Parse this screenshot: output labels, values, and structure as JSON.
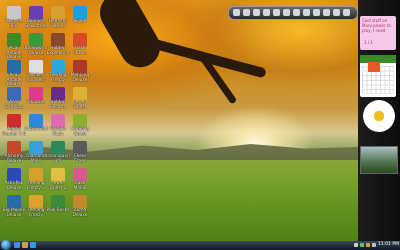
{
  "desktop": {
    "icons": [
      {
        "label": "Recycle Bin",
        "color": "#c8c8c8"
      },
      {
        "label": "Bonnie's Bookstore",
        "color": "#6a3fb5"
      },
      {
        "label": "Hamster Heroes",
        "color": "#d8a030"
      },
      {
        "label": "Skype",
        "color": "#1aa0e0"
      },
      {
        "label": "Acai Arcade Deluxe",
        "color": "#3b8a2a"
      },
      {
        "label": "Bookworm Deluxe",
        "color": "#3a9a3a"
      },
      {
        "label": "Hidden Expedition",
        "color": "#8a4a2a"
      },
      {
        "label": "Flash Puzzle",
        "color": "#d84a2a"
      },
      {
        "label": "Acai Arcade Deluxe",
        "color": "#2a6aa8"
      },
      {
        "label": "Chicken Invaders",
        "color": "#e0e0e0"
      },
      {
        "label": "Feeding Frenzy",
        "color": "#2aa8d8"
      },
      {
        "label": "Mahjong Deluxe",
        "color": "#a83a2a"
      },
      {
        "label": "Acer GridVista",
        "color": "#3a6ab8"
      },
      {
        "label": "Chuzzle",
        "color": "#e03a8a"
      },
      {
        "label": "Hidden Secrets",
        "color": "#6a2a8a"
      },
      {
        "label": "Jewel Quest",
        "color": "#e0b030"
      },
      {
        "label": "Adobe Reader 7.0",
        "color": "#d02a2a"
      },
      {
        "label": "Cubis Gold",
        "color": "#2a8ad8"
      },
      {
        "label": "Fashion Rush",
        "color": "#e06ab0"
      },
      {
        "label": "Mahjong Quest",
        "color": "#8ab030"
      },
      {
        "label": "Alchemy Deluxe",
        "color": "#c04a2a"
      },
      {
        "label": "Diamond Mine",
        "color": "#3aa0d8"
      },
      {
        "label": "Insaniquarium",
        "color": "#2a8a5a"
      },
      {
        "label": "Chess Titans",
        "color": "#5a5a5a"
      },
      {
        "label": "AstroPop Deluxe",
        "color": "#2a4ab8"
      },
      {
        "label": "Feeding Frenzy 2",
        "color": "#d8a02a"
      },
      {
        "label": "Jewel Quest 2",
        "color": "#e0c040"
      },
      {
        "label": "Cake Mania",
        "color": "#d85a8a"
      },
      {
        "label": "Big Money Deluxe",
        "color": "#2a6aa8"
      },
      {
        "label": "Feeding Frenzy",
        "color": "#e0a030"
      },
      {
        "label": "Pool Rocks",
        "color": "#3a8a3a"
      },
      {
        "label": "Zuma Deluxe",
        "color": "#c08a2a"
      }
    ]
  },
  "sidebar": {
    "note_text": "Cool stuff on Mary-power to play, I need",
    "note_nav": "1 / 1",
    "calendar_month": "",
    "accent": "#3a8a2a"
  },
  "taskbar": {
    "time": "11:01 PM"
  },
  "colors": {
    "taskbar_top": "#3a4a5a",
    "taskbar_bottom": "#0e1622",
    "sidebar_bg": "#121212"
  }
}
